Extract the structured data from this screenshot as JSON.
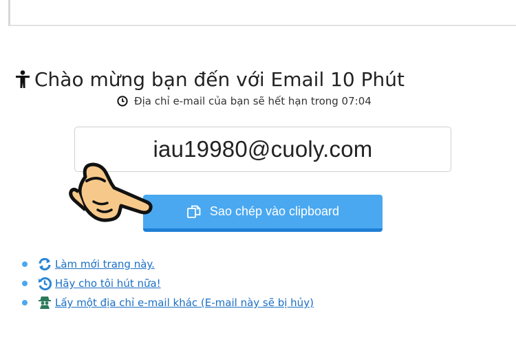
{
  "header": {
    "title": "Chào mừng bạn đến với Email 10 Phút",
    "title_icon": "user-icon"
  },
  "expiry": {
    "icon": "clock-icon",
    "text": "Địa chỉ e-mail của bạn sẽ hết hạn trong 07:04"
  },
  "email": {
    "address": "iau19980@cuoly.com"
  },
  "copy_button": {
    "label": "Sao chép vào clipboard",
    "icon": "copy-icon",
    "color": "#4aa8f0"
  },
  "pointer": {
    "icon": "pointing-hand-icon"
  },
  "links": [
    {
      "icon": "refresh-icon",
      "label": "Làm mới trang này."
    },
    {
      "icon": "history-icon",
      "label": "Hãy cho tôi hút nữa!"
    },
    {
      "icon": "spy-icon",
      "label": "Lấy một địa chỉ e-mail khác (E-mail này sẽ bị hủy)"
    }
  ],
  "colors": {
    "accent": "#4aa8f0",
    "link": "#1b6fc4",
    "link_icon": "#2a86d6"
  }
}
